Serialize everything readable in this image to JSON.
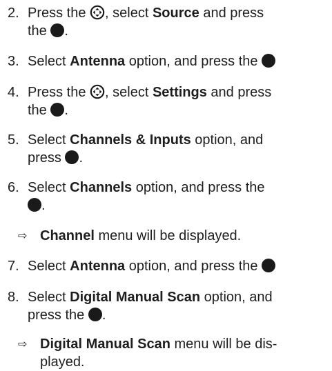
{
  "colors": {
    "text": "#1e1e1e",
    "bullet": "#1a1a1a"
  },
  "icons": {
    "nav": "directional-pad-icon",
    "ok": "ok-button-dot-icon",
    "result": "result-arrow-icon"
  },
  "steps": [
    {
      "num": "2.",
      "t1": "Press the ",
      "t2": ", select ",
      "b1": "Source",
      "t3": " and press",
      "t4": "the ",
      "t5": "."
    },
    {
      "num": "3.",
      "t1": "Select ",
      "b1": "Antenna",
      "t2": " option, and press the "
    },
    {
      "num": "4.",
      "t1": "Press the ",
      "t2": ", select ",
      "b1": "Settings",
      "t3": " and press",
      "t4": "the ",
      "t5": "."
    },
    {
      "num": "5.",
      "t1": "Select ",
      "b1": "Channels & Inputs",
      "t2": " option, and",
      "t3": "press ",
      "t4": "."
    },
    {
      "num": "6.",
      "t1": "Select ",
      "b1": "Channels",
      "t2": " option, and press the",
      "t3": "."
    },
    {
      "b1": "Channel",
      "t1": " menu will be displayed."
    },
    {
      "num": "7.",
      "t1": "Select ",
      "b1": "Antenna",
      "t2": " option, and press the "
    },
    {
      "num": "8.",
      "t1": "Select ",
      "b1": "Digital Manual Scan",
      "t2": " option, and",
      "t3": "press the ",
      "t4": "."
    },
    {
      "b1": "Digital Manual Scan",
      "t1": " menu will be dis-",
      "t2": "played."
    }
  ],
  "result_arrow": "⇨"
}
